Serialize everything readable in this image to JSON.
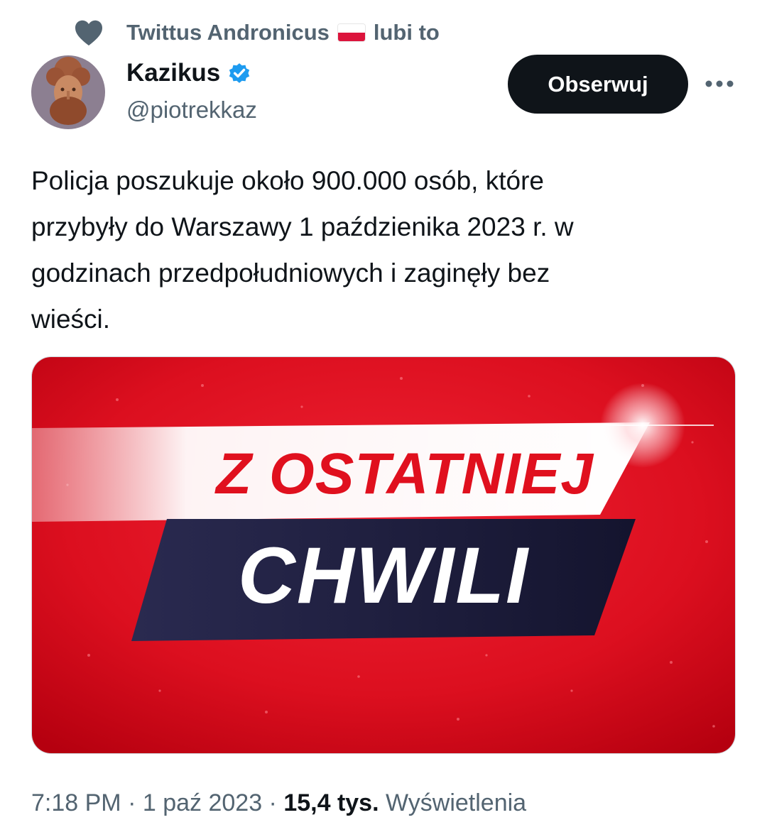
{
  "social_context": {
    "user": "Twittus Andronicus",
    "action": "lubi to",
    "icon": "heart-icon",
    "flag": "poland-flag"
  },
  "author": {
    "name": "Kazikus",
    "handle": "@piotrekkaz",
    "verified": true
  },
  "follow_label": "Obserwuj",
  "tweet_text": "Policja poszukuje około 900.000 osób, które\nprzybyły do Warszawy 1 paździenika 2023 r. w\ngodzinach przedpołudniowych i zaginęły bez\nwieści.",
  "media": {
    "line1": "Z OSTATNIEJ",
    "line2": "CHWILI",
    "colors": {
      "red": "#e0101e",
      "navy": "#1b1b3c",
      "white": "#ffffff"
    }
  },
  "meta": {
    "time": "7:18 PM",
    "date": "1 paź 2023",
    "separator": " · ",
    "views_count": "15,4 tys.",
    "views_label": "Wyświetlenia"
  },
  "colors": {
    "primary_text": "#0f1419",
    "secondary_text": "#536471",
    "verified_blue": "#1d9bf0"
  }
}
